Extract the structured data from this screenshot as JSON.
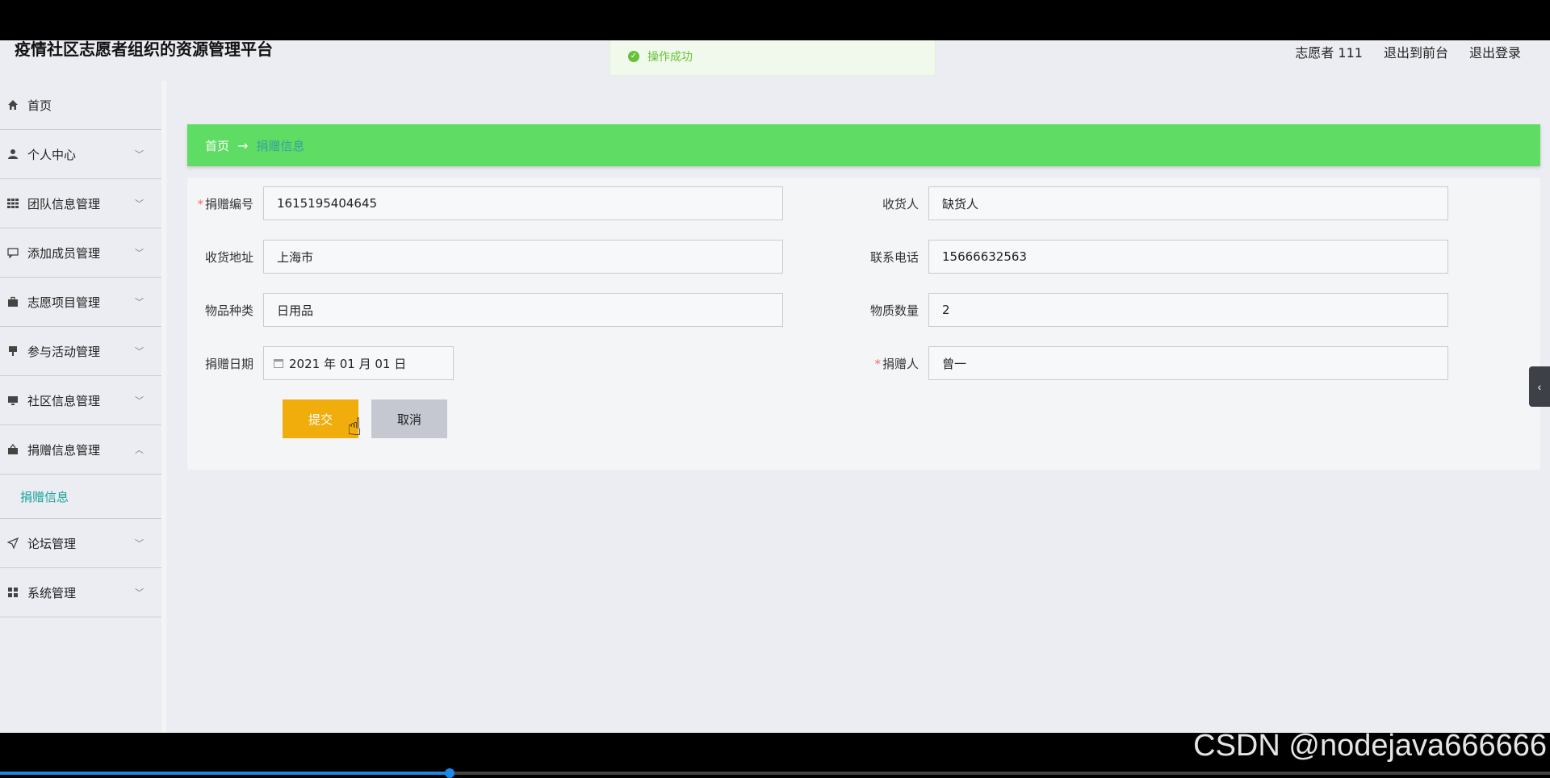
{
  "app": {
    "title": "疫情社区志愿者组织的资源管理平台",
    "user_label": "志愿者 111",
    "front_link": "退出到前台",
    "logout_link": "退出登录"
  },
  "toast": {
    "message": "操作成功"
  },
  "sidebar": {
    "items": [
      {
        "label": "首页",
        "icon": "home-icon"
      },
      {
        "label": "个人中心",
        "icon": "user-icon"
      },
      {
        "label": "团队信息管理",
        "icon": "grid-icon"
      },
      {
        "label": "添加成员管理",
        "icon": "message-icon"
      },
      {
        "label": "志愿项目管理",
        "icon": "briefcase-icon"
      },
      {
        "label": "参与活动管理",
        "icon": "flag-icon"
      },
      {
        "label": "社区信息管理",
        "icon": "monitor-icon"
      },
      {
        "label": "捐赠信息管理",
        "icon": "box-icon",
        "expanded": true
      },
      {
        "label": "论坛管理",
        "icon": "send-icon"
      },
      {
        "label": "系统管理",
        "icon": "apps-icon"
      }
    ],
    "submenu": {
      "label": "捐赠信息"
    }
  },
  "breadcrumb": {
    "home": "首页",
    "current": "捐赠信息"
  },
  "form": {
    "donation_no": {
      "label": "捐赠编号",
      "value": "1615195404645",
      "required": true
    },
    "receiver": {
      "label": "收货人",
      "value": "缺货人"
    },
    "address": {
      "label": "收货地址",
      "value": "上海市"
    },
    "phone": {
      "label": "联系电话",
      "value": "15666632563"
    },
    "category": {
      "label": "物品种类",
      "value": "日用品"
    },
    "quantity": {
      "label": "物质数量",
      "value": "2"
    },
    "date": {
      "label": "捐赠日期",
      "value": "2021 年 01 月 01 日"
    },
    "donor": {
      "label": "捐赠人",
      "value": "曾一",
      "required": true
    },
    "submit_label": "提交",
    "cancel_label": "取消"
  },
  "watermark": "CSDN @nodejava666666",
  "video_progress": 0.29
}
